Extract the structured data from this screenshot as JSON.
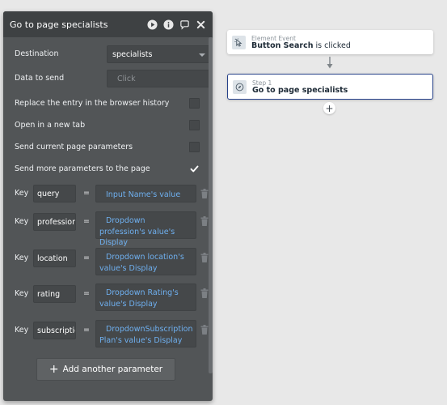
{
  "colors": {
    "panel_bg": "#525557",
    "panel_header": "#3e4143",
    "dynamic_value": "#6fb0f0",
    "selected_border": "#27428a"
  },
  "panel": {
    "title": "Go to page specialists",
    "header_icons": [
      "play-icon",
      "info-icon",
      "comment-icon",
      "close-icon"
    ],
    "destination_label": "Destination",
    "destination_value": "specialists",
    "data_to_send_label": "Data to send",
    "data_to_send_placeholder": "Click",
    "options": [
      {
        "label": "Replace the entry in the browser history",
        "checked": false
      },
      {
        "label": "Open in a new tab",
        "checked": false
      },
      {
        "label": "Send current page parameters",
        "checked": false
      },
      {
        "label": "Send more parameters to the page",
        "checked": true
      }
    ],
    "key_label": "Key",
    "eq_label": "=",
    "parameters": [
      {
        "key": "query",
        "value": "Input Name's value"
      },
      {
        "key": "profession",
        "value": "Dropdown profession's value's Display"
      },
      {
        "key": "location",
        "value": "Dropdown location's value's Display"
      },
      {
        "key": "rating",
        "value": "Dropdown Rating's value's Display"
      },
      {
        "key": "subscription",
        "value": "DropdownSubscription Plan's value's Display"
      }
    ],
    "add_param_plus": "+",
    "add_param_label": "Add another parameter"
  },
  "workflow": {
    "event_card": {
      "sub": "Element Event",
      "main_prefix": "Button Search",
      "main_suffix": " is clicked"
    },
    "step_card": {
      "sub": "Step 1",
      "main": "Go to page specialists"
    },
    "add_step": "+"
  }
}
